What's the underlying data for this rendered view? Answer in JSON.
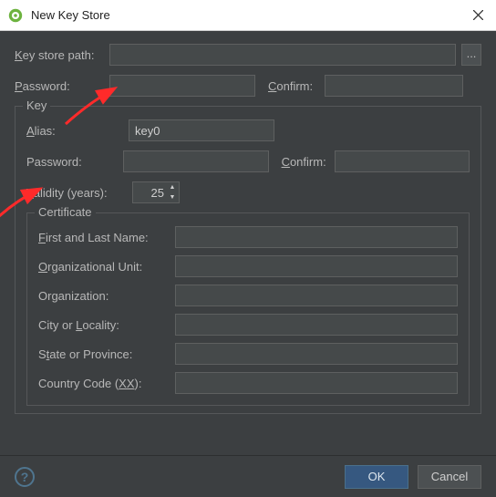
{
  "window": {
    "title": "New Key Store"
  },
  "labels": {
    "key_store_path": "ey store path:",
    "key_store_path_mn": "K",
    "password": "assword:",
    "password_mn": "P",
    "confirm": "onfirm:",
    "confirm_mn": "C",
    "key_group": "Key",
    "alias": "lias:",
    "alias_mn": "A",
    "key_password": "Password:",
    "key_password_mn": "",
    "key_confirm": "onfirm:",
    "key_confirm_mn": "C",
    "validity": "alidity (years):",
    "validity_mn": "V",
    "certificate_group": "Certificate",
    "first_last": "irst and Last Name:",
    "first_last_mn": "F",
    "org_unit": "rganizational Unit:",
    "org_unit_mn": "O",
    "organization": "Organization:",
    "city": "City or ",
    "city_mn": "L",
    "city_rest": "ocality:",
    "state": "S",
    "state_mn": "t",
    "state_rest": "ate or Province:",
    "country": "Country Code (",
    "country_mn": "XX",
    "country_rest": "):"
  },
  "values": {
    "alias": "key0",
    "validity": "25",
    "browse": "..."
  },
  "buttons": {
    "ok": "OK",
    "cancel": "Cancel"
  }
}
